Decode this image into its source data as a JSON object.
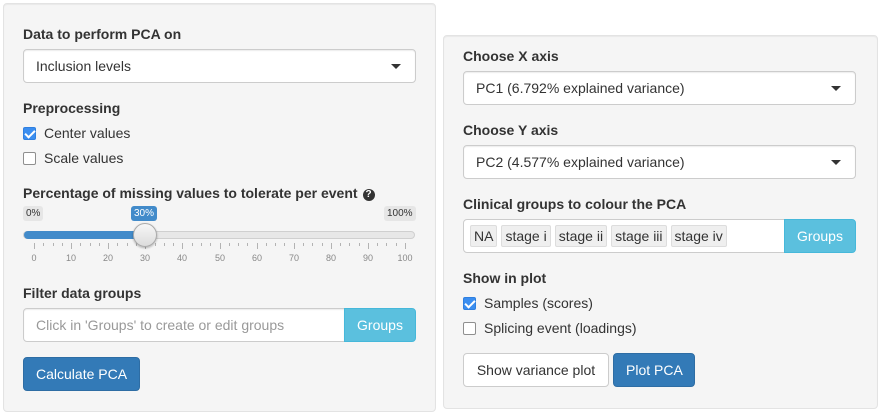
{
  "left": {
    "data_label": "Data to perform PCA on",
    "data_select": "Inclusion levels",
    "preprocessing_label": "Preprocessing",
    "center_values": {
      "label": "Center values",
      "checked": true
    },
    "scale_values": {
      "label": "Scale values",
      "checked": false
    },
    "missing_label": "Percentage of missing values to tolerate per event",
    "slider": {
      "min_label": "0%",
      "max_label": "100%",
      "value_label": "30%",
      "value": 30,
      "ticks": [
        "0",
        "10",
        "20",
        "30",
        "40",
        "50",
        "60",
        "70",
        "80",
        "90",
        "100"
      ]
    },
    "filter_label": "Filter data groups",
    "filter_placeholder": "Click in 'Groups' to create or edit groups",
    "groups_button": "Groups",
    "calculate_button": "Calculate PCA"
  },
  "right": {
    "x_axis_label": "Choose X axis",
    "x_axis_select": "PC1 (6.792% explained variance)",
    "y_axis_label": "Choose Y axis",
    "y_axis_select": "PC2 (4.577% explained variance)",
    "clinical_label": "Clinical groups to colour the PCA",
    "clinical_tags": [
      "NA",
      "stage i",
      "stage ii",
      "stage iii",
      "stage iv"
    ],
    "groups_button": "Groups",
    "show_label": "Show in plot",
    "samples": {
      "label": "Samples (scores)",
      "checked": true
    },
    "splicing": {
      "label": "Splicing event (loadings)",
      "checked": false
    },
    "variance_button": "Show variance plot",
    "plot_button": "Plot PCA"
  },
  "colors": {
    "primary": "#337ab7",
    "info": "#5bc0de",
    "slider": "#428bca",
    "checkbox": "#3b8ef0"
  },
  "icons": {
    "help": "question-circle-icon",
    "caret": "caret-down-icon"
  }
}
